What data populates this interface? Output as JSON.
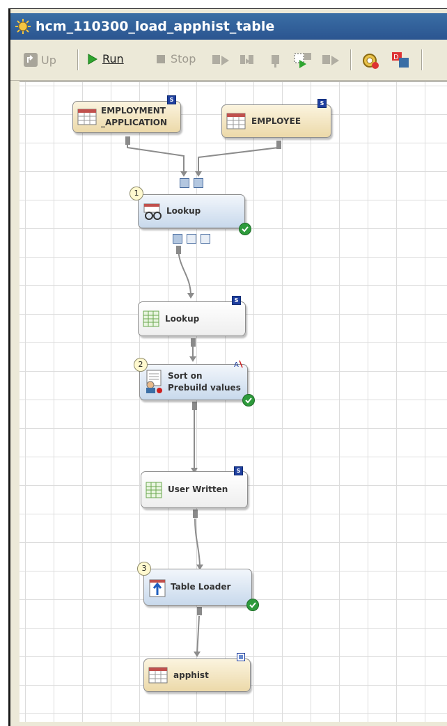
{
  "window": {
    "title": "hcm_110300_load_apphist_table"
  },
  "toolbar": {
    "up_label": "Up",
    "run_label": "Run",
    "stop_label": "Stop"
  },
  "nodes": {
    "employment_application": {
      "label_line1": "EMPLOYMENT",
      "label_line2": "_APPLICATION",
      "badge": "S"
    },
    "employee": {
      "label": "EMPLOYEE",
      "badge": "S"
    },
    "lookup_transform": {
      "label": "Lookup",
      "step": "1"
    },
    "lookup_table": {
      "label": "Lookup",
      "badge": "S"
    },
    "sort": {
      "label_line1": "Sort on",
      "label_line2": "Prebuild values",
      "step": "2"
    },
    "user_written": {
      "label": "User Written",
      "badge": "S"
    },
    "table_loader": {
      "label": "Table Loader",
      "step": "3"
    },
    "apphist": {
      "label": "apphist"
    }
  },
  "colors": {
    "title_bar": "#2b5590",
    "table_node": "#ecd9a9",
    "transform_node": "#c8d9ec",
    "status_ok": "#2e9b3c",
    "badge": "#1f3f9e"
  }
}
